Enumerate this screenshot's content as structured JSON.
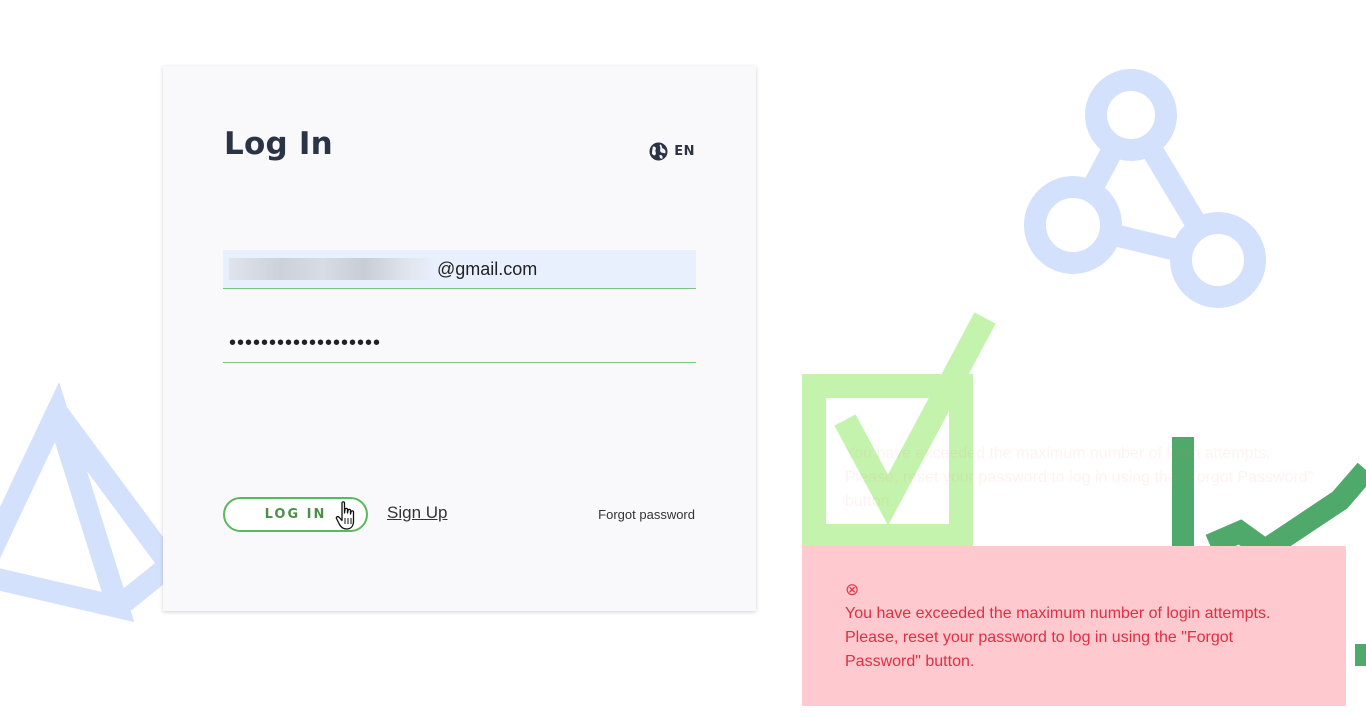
{
  "login": {
    "title": "Log In",
    "language": "EN",
    "email_value": "@gmail.com",
    "password_value": "•••••••••••••••••••",
    "login_button": "LOG IN",
    "signup_link": "Sign Up",
    "forgot_link": "Forgot password"
  },
  "alert": {
    "icon": "⊗",
    "message": "You have exceeded the maximum number of login attempts. Please, reset your password to log in using the \"Forgot Password\" button."
  },
  "icons": {
    "language": "globe-icon",
    "alert": "error-circle-x-icon",
    "cursor": "hand-pointer-icon"
  },
  "colors": {
    "accent_green": "#5cb85c",
    "decor_blue": "#d4e1fd",
    "decor_light_green": "#c3f3ad",
    "decor_dark_green": "#4fa96a",
    "alert_bg": "#ffcacf",
    "alert_text": "#e02e44"
  }
}
